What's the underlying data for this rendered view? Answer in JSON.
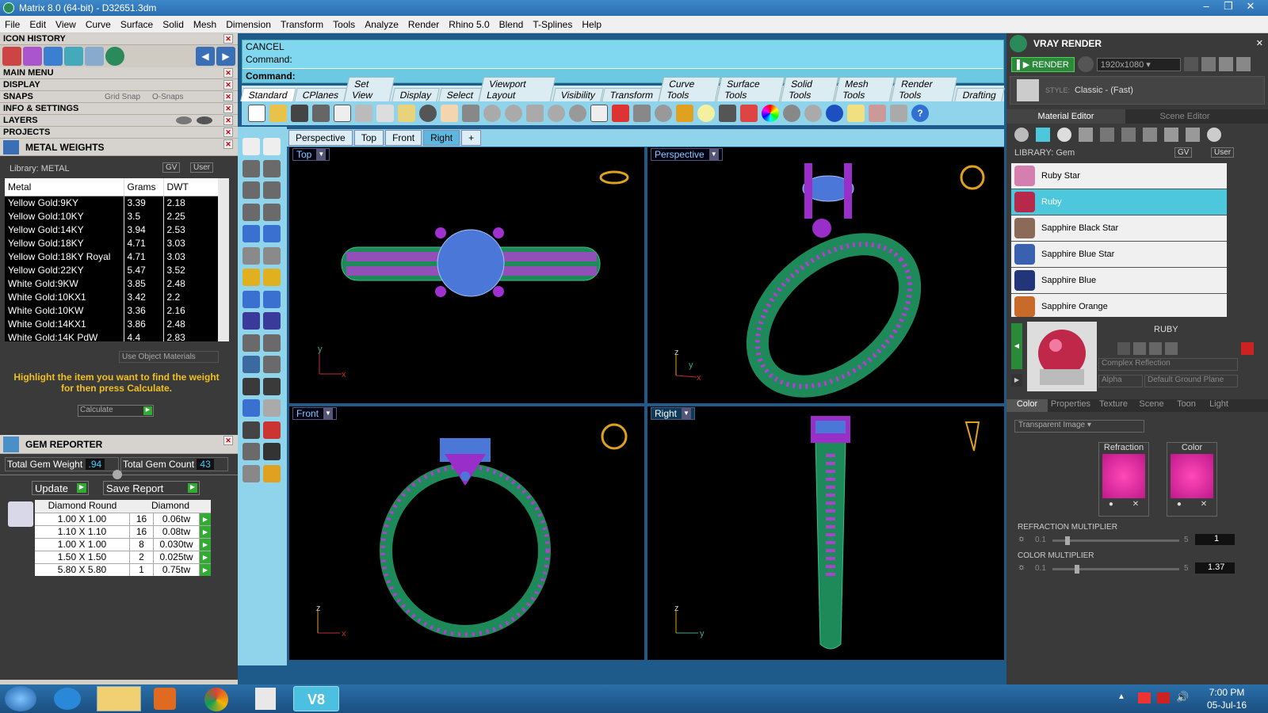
{
  "window": {
    "title": "Matrix 8.0 (64-bit) - D32651.3dm",
    "controls": [
      "–",
      "❐",
      "✕"
    ]
  },
  "menu": [
    "File",
    "Edit",
    "View",
    "Curve",
    "Surface",
    "Solid",
    "Mesh",
    "Dimension",
    "Transform",
    "Tools",
    "Analyze",
    "Render",
    "Rhino 5.0",
    "Blend",
    "T-Splines",
    "Help"
  ],
  "left": {
    "icon_history": "ICON HISTORY",
    "main_menu": "MAIN MENU",
    "display": "DISPLAY",
    "snaps": "SNAPS",
    "grid_snap": "Grid Snap",
    "o_snaps": "O-Snaps",
    "info_settings": "INFO & SETTINGS",
    "layers": "LAYERS",
    "projects": "PROJECTS",
    "metal_weights": "METAL WEIGHTS",
    "library": "Library: METAL",
    "gv": "GV",
    "user": "User",
    "table_headers": [
      "Metal",
      "Grams",
      "DWT"
    ],
    "metals": [
      [
        "Yellow Gold:9KY",
        "3.39",
        "2.18"
      ],
      [
        "Yellow Gold:10KY",
        "3.5",
        "2.25"
      ],
      [
        "Yellow Gold:14KY",
        "3.94",
        "2.53"
      ],
      [
        "Yellow Gold:18KY",
        "4.71",
        "3.03"
      ],
      [
        "Yellow Gold:18KY Royal",
        "4.71",
        "3.03"
      ],
      [
        "Yellow Gold:22KY",
        "5.47",
        "3.52"
      ],
      [
        "White Gold:9KW",
        "3.85",
        "2.48"
      ],
      [
        "White Gold:10KX1",
        "3.42",
        "2.2"
      ],
      [
        "White Gold:10KW",
        "3.36",
        "2.16"
      ],
      [
        "White Gold:14KX1",
        "3.86",
        "2.48"
      ],
      [
        "White Gold:14K PdW",
        "4.4",
        "2.83"
      ]
    ],
    "use_object_materials": "Use Object Materials",
    "highlight_msg": "Highlight the item you want to find the weight for then press Calculate.",
    "calculate": "Calculate",
    "gem_reporter": "GEM REPORTER",
    "total_gem_weight_label": "Total Gem Weight",
    "total_gem_weight": ".94",
    "total_gem_count_label": "Total Gem Count",
    "total_gem_count": "43",
    "update": "Update",
    "save_report": "Save Report",
    "gem_headers": [
      "Diamond Round",
      "Diamond"
    ],
    "gems": [
      [
        "1.00 X 1.00",
        "16",
        "0.06tw"
      ],
      [
        "1.10 X 1.10",
        "16",
        "0.08tw"
      ],
      [
        "1.00 X 1.00",
        "8",
        "0.030tw"
      ],
      [
        "1.50 X 1.50",
        "2",
        "0.025tw"
      ],
      [
        "5.80 X 5.80",
        "1",
        "0.75tw"
      ]
    ]
  },
  "command": {
    "line1": "CANCEL",
    "line2": "Command:",
    "line3": "Command:"
  },
  "toolbar_tabs": [
    "Standard",
    "CPlanes",
    "Set View",
    "Display",
    "Select",
    "Viewport Layout",
    "Visibility",
    "Transform",
    "Curve Tools",
    "Surface Tools",
    "Solid Tools",
    "Mesh Tools",
    "Render Tools",
    "Drafting"
  ],
  "view_tabs": [
    "Perspective",
    "Top",
    "Front",
    "Right"
  ],
  "viewports": {
    "top": "Top",
    "perspective": "Perspective",
    "front": "Front",
    "right": "Right"
  },
  "axes": {
    "x": "x",
    "y": "y",
    "z": "z"
  },
  "right": {
    "vray_render": "VRAY RENDER",
    "render": "RENDER",
    "resolution": "1920x1080",
    "style_label": "STYLE:",
    "style_value": "Classic - (Fast)",
    "material_editor": "Material Editor",
    "scene_editor": "Scene Editor",
    "library": "LIBRARY: Gem",
    "gv": "GV",
    "user": "User",
    "materials": [
      "Ruby Star",
      "Ruby",
      "Sapphire Black Star",
      "Sapphire Blue Star",
      "Sapphire Blue",
      "Sapphire Orange"
    ],
    "selected_material": "RUBY",
    "complex_reflection": "Complex Reflection",
    "alpha": "Alpha",
    "default_ground_plane": "Default Ground Plane",
    "subtabs": [
      "Color",
      "Properties",
      "Texture",
      "Scene",
      "Toon",
      "Light"
    ],
    "transparent_image": "Transparent Image",
    "refraction": "Refraction",
    "color": "Color",
    "refraction_multiplier": "REFRACTION MULTIPLIER",
    "refraction_min": "0.1",
    "refraction_max": "5",
    "refraction_value": "1",
    "color_multiplier": "COLOR MULTIPLIER",
    "color_min": "0.1",
    "color_max": "5",
    "color_value": "1.37"
  },
  "taskbar": {
    "time": "7:00 PM",
    "date": "05-Jul-16"
  }
}
